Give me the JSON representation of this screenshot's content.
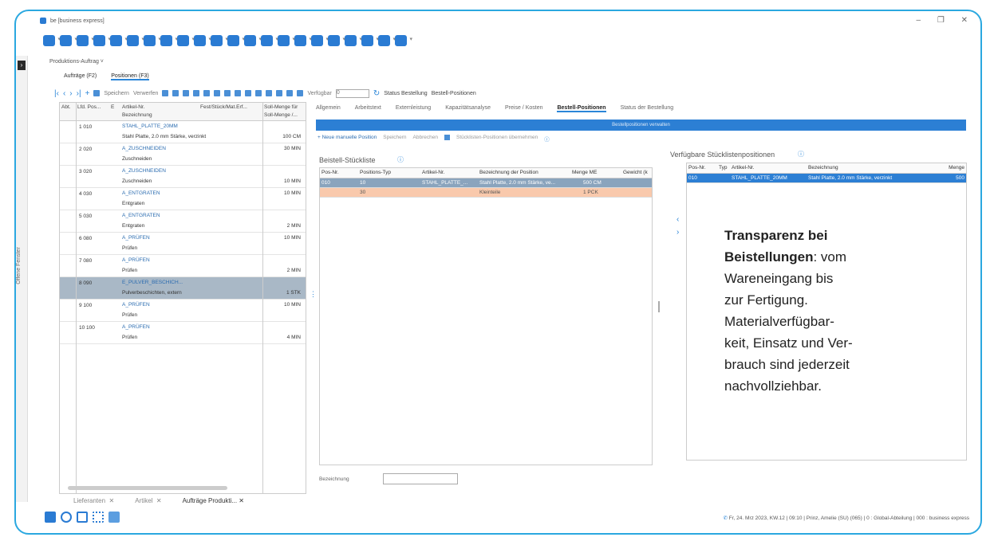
{
  "window": {
    "title": "be [business express]",
    "controls": [
      "–",
      "❐",
      "✕"
    ]
  },
  "toolbar_icons": [
    {
      "name": "app-icon",
      "color": "#2a7bd3"
    },
    {
      "name": "box-icon",
      "color": "#2a7bd3"
    },
    {
      "name": "users-icon",
      "color": "#2a7bd3"
    },
    {
      "name": "group-icon",
      "color": "#2a7bd3"
    },
    {
      "name": "truck-icon",
      "color": "#2a7bd3"
    },
    {
      "name": "doc-icon",
      "color": "#2a7bd3"
    },
    {
      "name": "calc-icon",
      "color": "#2a7bd3"
    },
    {
      "name": "tag-icon",
      "color": "#2a7bd3"
    },
    {
      "name": "clock-icon",
      "color": "#2a7bd3"
    },
    {
      "name": "factory-icon",
      "color": "#2a7bd3"
    },
    {
      "name": "factory2-icon",
      "color": "#2a7bd3"
    },
    {
      "name": "chart-icon",
      "color": "#2a7bd3"
    },
    {
      "name": "book-icon",
      "color": "#2a7bd3"
    },
    {
      "name": "edit-icon",
      "color": "#2a7bd3"
    },
    {
      "name": "calendar-icon",
      "color": "#2a7bd3"
    },
    {
      "name": "binoculars-icon",
      "color": "#2a7bd3"
    },
    {
      "name": "report-icon",
      "color": "#2a7bd3"
    },
    {
      "name": "graph-icon",
      "color": "#2a7bd3"
    },
    {
      "name": "wrench-icon",
      "color": "#2a7bd3"
    },
    {
      "name": "user-icon",
      "color": "#2a7bd3"
    },
    {
      "name": "info-icon",
      "color": "#2a7bd3"
    },
    {
      "name": "list-icon",
      "color": "#2a7bd3"
    }
  ],
  "sidebar": {
    "label": "Offene Fenster"
  },
  "breadcrumb": "Produktions-Auftrag ˅",
  "top_tabs": [
    {
      "label": "Aufträge (F2)",
      "active": false
    },
    {
      "label": "Positionen (F3)",
      "active": true
    }
  ],
  "nav": {
    "save": "Speichern",
    "discard": "Verwerfen",
    "available_label": "Verfügbar",
    "available_value": "0",
    "status_order": "Status Bestellung",
    "order_positions": "Bestell-Positionen"
  },
  "left_table": {
    "headers": {
      "abt": "Abt.",
      "lfd": "Lfd. Pos...",
      "e": "E",
      "artikel": "Artikel-Nr.",
      "bezeichnung": "Bezeichnung",
      "fest": "Fest/Stück/Mat.Erf...",
      "soll1": "Soll-Menge für",
      "soll2": "Soll-Menge /..."
    },
    "rows": [
      {
        "pos": "1 010",
        "artikel": "STAHL_PLATTE_20MM",
        "bez": "Stahl Platte, 2.0 mm Stärke, verzinkt",
        "qty": "100 CM",
        "qty_top": "",
        "selected": false
      },
      {
        "pos": "2 020",
        "artikel": "A_ZUSCHNEIDEN",
        "bez": "Zuschneiden",
        "qty": "",
        "qty_top": "30 MIN",
        "selected": false
      },
      {
        "pos": "3 020",
        "artikel": "A_ZUSCHNEIDEN",
        "bez": "Zuschneiden",
        "qty": "10 MIN",
        "qty_top": "",
        "selected": false
      },
      {
        "pos": "4 030",
        "artikel": "A_ENTGRATEN",
        "bez": "Entgraten",
        "qty": "",
        "qty_top": "10 MIN",
        "selected": false
      },
      {
        "pos": "5 030",
        "artikel": "A_ENTGRATEN",
        "bez": "Entgraten",
        "qty": "2 MIN",
        "qty_top": "",
        "selected": false
      },
      {
        "pos": "6 080",
        "artikel": "A_PRÜFEN",
        "bez": "Prüfen",
        "qty": "",
        "qty_top": "10 MIN",
        "selected": false
      },
      {
        "pos": "7 080",
        "artikel": "A_PRÜFEN",
        "bez": "Prüfen",
        "qty": "2 MIN",
        "qty_top": "",
        "selected": false
      },
      {
        "pos": "8 090",
        "artikel": "E_PULVER_BESCHICH...",
        "bez": "Pulverbeschichten, extern",
        "qty": "1 STK",
        "qty_top": "",
        "selected": true
      },
      {
        "pos": "9 100",
        "artikel": "A_PRÜFEN",
        "bez": "Prüfen",
        "qty": "",
        "qty_top": "10 MIN",
        "selected": false
      },
      {
        "pos": "10 100",
        "artikel": "A_PRÜFEN",
        "bez": "Prüfen",
        "qty": "4 MIN",
        "qty_top": "",
        "selected": false
      }
    ]
  },
  "detail_tabs": [
    {
      "label": "Allgemein",
      "active": false
    },
    {
      "label": "Arbeitstext",
      "active": false
    },
    {
      "label": "Externleistung",
      "active": false
    },
    {
      "label": "Kapazitätsanalyse",
      "active": false
    },
    {
      "label": "Preise / Kosten",
      "active": false
    },
    {
      "label": "Bestell-Positionen",
      "active": true
    },
    {
      "label": "Status der Bestellung",
      "active": false
    }
  ],
  "bluebar": "Bestellpositionen verwalten",
  "actions": {
    "new_manual": "+ Neue manuelle Position",
    "save": "Speichern",
    "cancel": "Abbrechen",
    "take_over": "Stücklisten-Positionen übernehmen"
  },
  "bom": {
    "title": "Beistell-Stückliste",
    "headers": {
      "pos": "Pos-Nr.",
      "typ": "Positions-Typ",
      "art": "Artikel-Nr.",
      "bez": "Bezeichnung der Position",
      "menge": "Menge ME",
      "gewicht": "Gewicht (k"
    },
    "rows": [
      {
        "pos": "010",
        "typ": "10",
        "art": "STAHL_PLATTE_...",
        "bez": "Stahl Platte, 2.0 mm Stärke, ve...",
        "menge": "500 CM",
        "style": "blue"
      },
      {
        "pos": "",
        "typ": "30",
        "art": "",
        "bez": "Kleinteile",
        "menge": "1 PCK",
        "style": "salmon"
      }
    ],
    "field_label": "Bezeichnung",
    "field_value": ""
  },
  "available": {
    "title": "Verfügbare Stücklistenpositionen",
    "headers": {
      "pos": "Pos-Nr.",
      "typ": "Typ",
      "art": "Artikel-Nr.",
      "bez": "Bezeichnung",
      "menge": "Menge"
    },
    "rows": [
      {
        "pos": "010",
        "typ": "",
        "art": "STAHL_PLATTE_20MM",
        "bez": "Stahl Platte, 2.0 mm Stärke, verzinkt",
        "menge": "500"
      }
    ]
  },
  "overlay": {
    "bold": "Transparenz bei Beistellungen",
    "line1": ": vom",
    "line2": "Wareneingang bis",
    "line3": "zur Fertigung.",
    "line4": "Materialverfügbar-",
    "line5": "keit, Einsatz und Ver-",
    "line6": "brauch sind jederzeit",
    "line7": "nachvollziehbar."
  },
  "bottom_tabs": [
    {
      "label": "Lieferanten",
      "active": false
    },
    {
      "label": "Artikel",
      "active": false
    },
    {
      "label": "Aufträge Produkti...",
      "active": true
    }
  ],
  "status_bar": "Fr, 24. Mrz 2023, KW.12 | 09:10 | Prinz, Amelie (SU) (065) | 0 : Global-Abteilung | 000 : business express"
}
